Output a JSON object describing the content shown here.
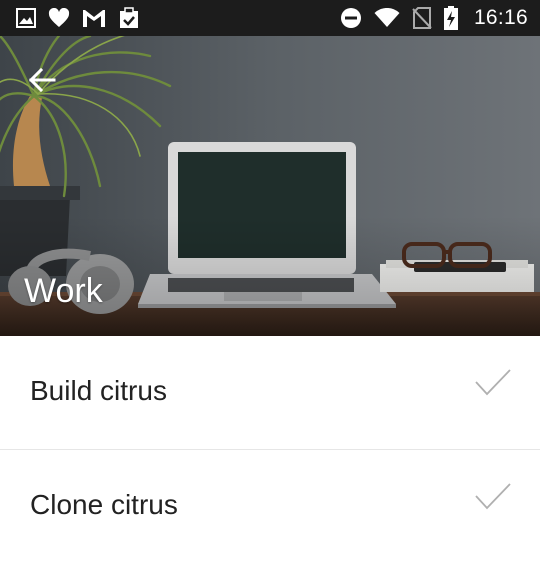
{
  "status_bar": {
    "time": "16:16",
    "left_icons": [
      "gallery-icon",
      "heart-icon",
      "gmail-icon",
      "clipboard-check-icon"
    ],
    "right_icons": [
      "do-not-disturb-icon",
      "wifi-icon",
      "no-sim-icon",
      "battery-charging-icon"
    ],
    "background": "#1c1c1c"
  },
  "header": {
    "title": "Work",
    "back_icon": "arrow-left-icon"
  },
  "tasks": [
    {
      "label": "Build citrus",
      "icon": "check-icon"
    },
    {
      "label": "Clone citrus",
      "icon": "check-icon"
    }
  ],
  "colors": {
    "text": "#222222",
    "check": "#b0b0b0",
    "divider": "#e6e6e6"
  }
}
